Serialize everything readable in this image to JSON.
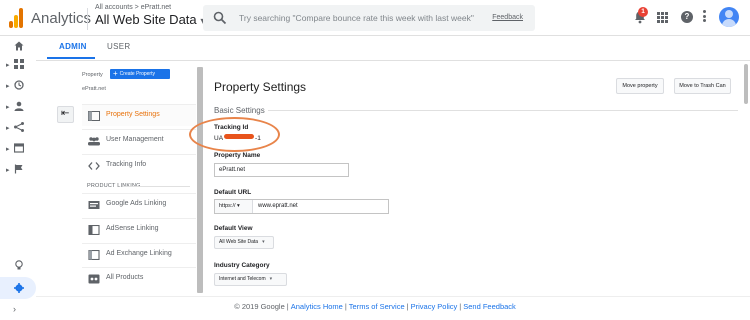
{
  "header": {
    "app_name": "Analytics",
    "breadcrumb": "All accounts > ePratt.net",
    "account_view": "All Web Site Data",
    "search_placeholder": "Try searching \"Compare bounce rate this week with last week\"",
    "feedback_label": "Feedback",
    "notification_count": "1"
  },
  "tabs": {
    "admin": "ADMIN",
    "user": "USER"
  },
  "property_column": {
    "label": "Property",
    "create_button": "Create Property",
    "property_name": "ePratt.net",
    "items": [
      {
        "label": "Property Settings",
        "icon": "settings-page-icon",
        "active": true
      },
      {
        "label": "User Management",
        "icon": "people-icon"
      },
      {
        "label": "Tracking Info",
        "icon": "code-icon"
      }
    ],
    "section_label": "PRODUCT LINKING",
    "linking_items": [
      {
        "label": "Google Ads Linking",
        "icon": "ads-icon"
      },
      {
        "label": "AdSense Linking",
        "icon": "adsense-icon"
      },
      {
        "label": "Ad Exchange Linking",
        "icon": "ad-exchange-icon"
      },
      {
        "label": "All Products",
        "icon": "all-products-icon"
      }
    ]
  },
  "main": {
    "title": "Property Settings",
    "move_button": "Move property",
    "trash_button": "Move to Trash Can",
    "basic_settings": "Basic Settings",
    "tracking_id_label": "Tracking Id",
    "tracking_id_prefix": "UA",
    "tracking_id_suffix": "-1",
    "property_name_label": "Property Name",
    "property_name_value": "ePratt.net",
    "default_url_label": "Default URL",
    "url_protocol": "https://",
    "url_value": "www.epratt.net",
    "default_view_label": "Default View",
    "default_view_value": "All Web Site Data",
    "industry_label": "Industry Category",
    "industry_value": "Internet and Telecom"
  },
  "footer": {
    "copyright": "© 2019 Google",
    "links": [
      "Analytics Home",
      "Terms of Service",
      "Privacy Policy",
      "Send Feedback"
    ]
  },
  "colors": {
    "accent": "#1a73e8",
    "active_item": "#e8710a",
    "annotation": "#e8844a"
  }
}
